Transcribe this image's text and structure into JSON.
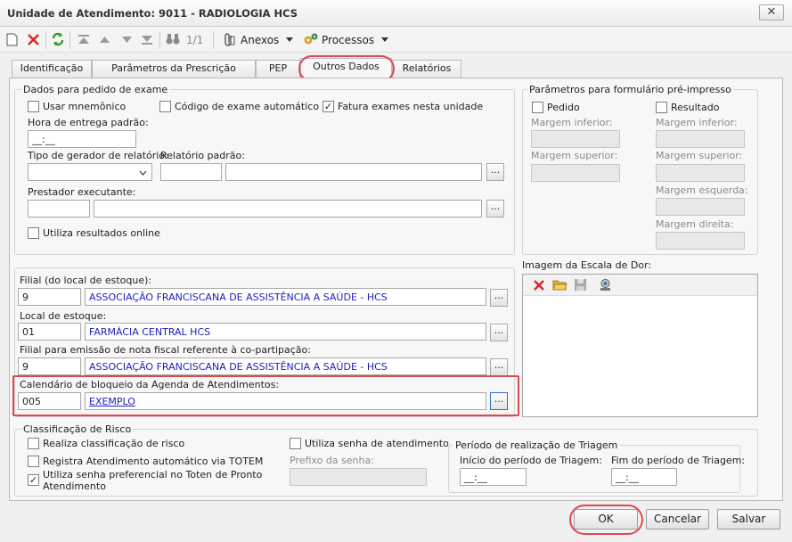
{
  "window": {
    "title": "Unidade de Atendimento: 9011 - RADIOLOGIA HCS",
    "close": "✕"
  },
  "toolbar": {
    "page_indicator": "1/1",
    "anexos": "Anexos",
    "processos": "Processos"
  },
  "tabs": [
    "Identificação",
    "Parâmetros da Prescrição",
    "PEP",
    "Outros Dados",
    "Relatórios"
  ],
  "exame": {
    "legend": "Dados para pedido de exame",
    "usar_mnemonico": "Usar mnemônico",
    "codigo_auto": "Código de exame automático",
    "fatura": "Fatura exames nesta unidade",
    "hora_label": "Hora de entrega padrão:",
    "hora_value": "__:__",
    "tipo_gerador_label": "Tipo de gerador de relatório:",
    "relatorio_label": "Relatório padrão:",
    "prestador_label": "Prestador executante:",
    "resultados_online": "Utiliza resultados online"
  },
  "preimpresso": {
    "legend": "Parâmetros para formulário pré-impresso",
    "pedido": "Pedido",
    "resultado": "Resultado",
    "margem_inferior": "Margem inferior:",
    "margem_superior": "Margem superior:",
    "margem_esquerda": "Margem esquerda:",
    "margem_direita": "Margem direita:"
  },
  "estoque": {
    "filial_label": "Filial (do local de estoque):",
    "filial_code": "9",
    "filial_name": "ASSOCIAÇÃO FRANCISCANA DE ASSISTÊNCIA A SAÚDE - HCS",
    "local_label": "Local de estoque:",
    "local_code": "01",
    "local_name": "FARMÁCIA CENTRAL HCS",
    "nf_label": "Filial para emissão de nota fiscal referente à co-partipação:",
    "nf_code": "9",
    "nf_name": "ASSOCIAÇÃO FRANCISCANA DE ASSISTÊNCIA A SAÚDE - HCS",
    "calendario_label": "Calendário de bloqueio da Agenda de Atendimentos:",
    "calendario_code": "005",
    "calendario_name": "EXEMPLO",
    "ellipsis": "..."
  },
  "escala_dor": {
    "label": "Imagem da Escala de Dor:"
  },
  "risco": {
    "legend": "Classificação de Risco",
    "realiza": "Realiza classificação de risco",
    "registra": "Registra Atendimento automático via TOTEM",
    "preferencial": "Utiliza senha preferencial no Toten de Pronto Atendimento",
    "senha": "Utiliza senha de atendimento",
    "prefixo_label": "Prefixo da senha:",
    "triagem_legend": "Período de realização de Triagem",
    "inicio_label": "Início do período de Triagem:",
    "fim_label": "Fim do período de Triagem:",
    "inicio_value": "__:__",
    "fim_value": "__:__"
  },
  "buttons": {
    "ok": "OK",
    "cancelar": "Cancelar",
    "salvar": "Salvar"
  },
  "checks": {
    "fatura": true,
    "preferencial": true
  },
  "colors": {
    "highlight": "#e0474c",
    "link": "#1d1dc0"
  }
}
